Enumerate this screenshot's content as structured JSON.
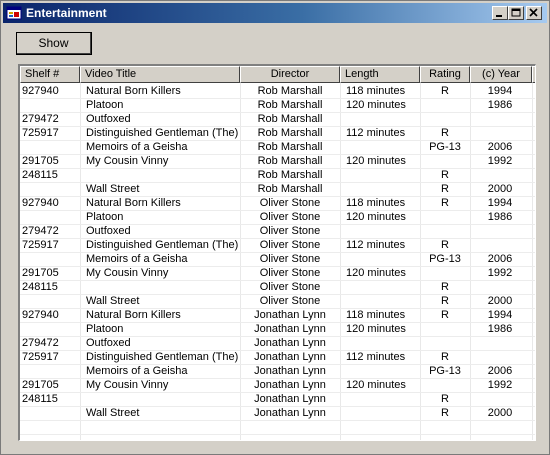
{
  "window": {
    "title": "Entertainment"
  },
  "toolbar": {
    "show_label": "Show"
  },
  "table": {
    "columns": [
      "Shelf #",
      "Video Title",
      "Director",
      "Length",
      "Rating",
      "(c) Year"
    ],
    "rows": [
      [
        "927940",
        "Natural Born Killers",
        "Rob Marshall",
        "118 minutes",
        "R",
        "1994"
      ],
      [
        "",
        "Platoon",
        "Rob Marshall",
        "120 minutes",
        "",
        "1986"
      ],
      [
        "279472",
        "Outfoxed",
        "Rob Marshall",
        "",
        "",
        ""
      ],
      [
        "725917",
        "Distinguished Gentleman (The)",
        "Rob Marshall",
        "112 minutes",
        "R",
        ""
      ],
      [
        "",
        "Memoirs of a Geisha",
        "Rob Marshall",
        "",
        "PG-13",
        "2006"
      ],
      [
        "291705",
        "My Cousin Vinny",
        "Rob Marshall",
        "120 minutes",
        "",
        "1992"
      ],
      [
        "248115",
        "",
        "Rob Marshall",
        "",
        "R",
        ""
      ],
      [
        "",
        "Wall Street",
        "Rob Marshall",
        "",
        "R",
        "2000"
      ],
      [
        "927940",
        "Natural Born Killers",
        "Oliver Stone",
        "118 minutes",
        "R",
        "1994"
      ],
      [
        "",
        "Platoon",
        "Oliver Stone",
        "120 minutes",
        "",
        "1986"
      ],
      [
        "279472",
        "Outfoxed",
        "Oliver Stone",
        "",
        "",
        ""
      ],
      [
        "725917",
        "Distinguished Gentleman (The)",
        "Oliver Stone",
        "112 minutes",
        "R",
        ""
      ],
      [
        "",
        "Memoirs of a Geisha",
        "Oliver Stone",
        "",
        "PG-13",
        "2006"
      ],
      [
        "291705",
        "My Cousin Vinny",
        "Oliver Stone",
        "120 minutes",
        "",
        "1992"
      ],
      [
        "248115",
        "",
        "Oliver Stone",
        "",
        "R",
        ""
      ],
      [
        "",
        "Wall Street",
        "Oliver Stone",
        "",
        "R",
        "2000"
      ],
      [
        "927940",
        "Natural Born Killers",
        "Jonathan Lynn",
        "118 minutes",
        "R",
        "1994"
      ],
      [
        "",
        "Platoon",
        "Jonathan Lynn",
        "120 minutes",
        "",
        "1986"
      ],
      [
        "279472",
        "Outfoxed",
        "Jonathan Lynn",
        "",
        "",
        ""
      ],
      [
        "725917",
        "Distinguished Gentleman (The)",
        "Jonathan Lynn",
        "112 minutes",
        "R",
        ""
      ],
      [
        "",
        "Memoirs of a Geisha",
        "Jonathan Lynn",
        "",
        "PG-13",
        "2006"
      ],
      [
        "291705",
        "My Cousin Vinny",
        "Jonathan Lynn",
        "120 minutes",
        "",
        "1992"
      ],
      [
        "248115",
        "",
        "Jonathan Lynn",
        "",
        "R",
        ""
      ],
      [
        "",
        "Wall Street",
        "Jonathan Lynn",
        "",
        "R",
        "2000"
      ]
    ]
  },
  "icons": {
    "app": "app-icon",
    "minimize": "minimize-icon",
    "maximize": "maximize-icon",
    "close": "close-icon"
  }
}
